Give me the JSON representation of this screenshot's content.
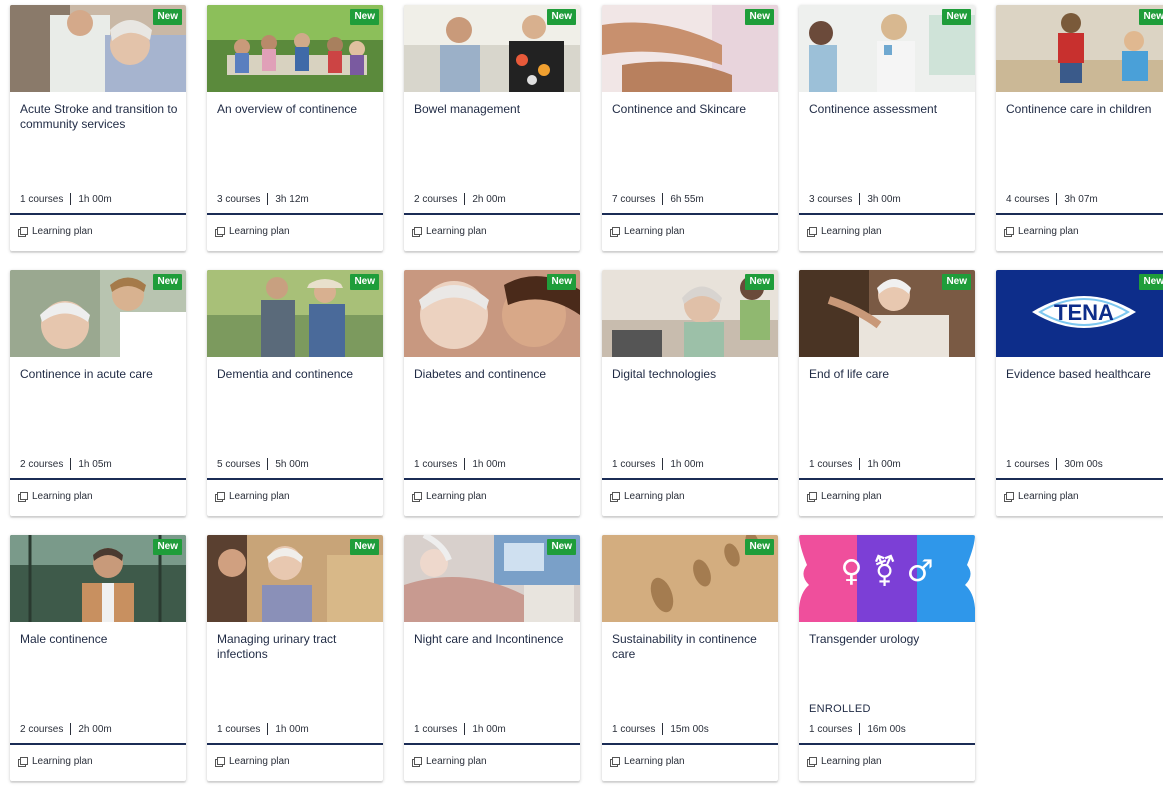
{
  "cards": [
    {
      "title": "Acute Stroke and transition to community services",
      "courses": "1 courses",
      "duration": "1h 00m",
      "badge": "New",
      "footer": "Learning plan",
      "image": "caregiver-with-elderly-woman",
      "enrolled": ""
    },
    {
      "title": "An overview of continence",
      "courses": "3 courses",
      "duration": "3h 12m",
      "badge": "New",
      "footer": "Learning plan",
      "image": "family-outdoor-dinner",
      "enrolled": ""
    },
    {
      "title": "Bowel management",
      "courses": "2 courses",
      "duration": "2h 00m",
      "badge": "New",
      "footer": "Learning plan",
      "image": "couple-at-home",
      "enrolled": ""
    },
    {
      "title": "Continence and Skincare",
      "courses": "7 courses",
      "duration": "6h 55m",
      "badge": "New",
      "footer": "Learning plan",
      "image": "hands-applying-cream",
      "enrolled": ""
    },
    {
      "title": "Continence assessment",
      "courses": "3 courses",
      "duration": "3h 00m",
      "badge": "New",
      "footer": "Learning plan",
      "image": "women-in-kitchen",
      "enrolled": ""
    },
    {
      "title": "Continence care in children",
      "courses": "4 courses",
      "duration": "3h 07m",
      "badge": "New",
      "footer": "Learning plan",
      "image": "children-on-beach",
      "enrolled": ""
    },
    {
      "title": "Continence in acute care",
      "courses": "2 courses",
      "duration": "1h 05m",
      "badge": "New",
      "footer": "Learning plan",
      "image": "nurse-with-smiling-patient",
      "enrolled": ""
    },
    {
      "title": "Dementia and continence",
      "courses": "5 courses",
      "duration": "5h 00m",
      "badge": "New",
      "footer": "Learning plan",
      "image": "two-men-walking",
      "enrolled": ""
    },
    {
      "title": "Diabetes and continence",
      "courses": "1 courses",
      "duration": "1h 00m",
      "badge": "New",
      "footer": "Learning plan",
      "image": "women-embracing",
      "enrolled": ""
    },
    {
      "title": "Digital technologies",
      "courses": "1 courses",
      "duration": "1h 00m",
      "badge": "New",
      "footer": "Learning plan",
      "image": "elderly-woman-laptop",
      "enrolled": ""
    },
    {
      "title": "End of life care",
      "courses": "1 courses",
      "duration": "1h 00m",
      "badge": "New",
      "footer": "Learning plan",
      "image": "hands-holding-elderly",
      "enrolled": ""
    },
    {
      "title": "Evidence based healthcare",
      "courses": "1 courses",
      "duration": "30m 00s",
      "badge": "New",
      "footer": "Learning plan",
      "image": "tena-logo",
      "logo_text": "TENA",
      "enrolled": ""
    },
    {
      "title": "Male continence",
      "courses": "2 courses",
      "duration": "2h 00m",
      "badge": "New",
      "footer": "Learning plan",
      "image": "man-in-greenhouse",
      "enrolled": ""
    },
    {
      "title": "Managing urinary tract infections",
      "courses": "1 courses",
      "duration": "1h 00m",
      "badge": "New",
      "footer": "Learning plan",
      "image": "elderly-woman-visit",
      "enrolled": ""
    },
    {
      "title": "Night care and Incontinence",
      "courses": "1 courses",
      "duration": "1h 00m",
      "badge": "New",
      "footer": "Learning plan",
      "image": "patient-in-bed",
      "enrolled": ""
    },
    {
      "title": "Sustainability in continence care",
      "courses": "1 courses",
      "duration": "15m 00s",
      "badge": "New",
      "footer": "Learning plan",
      "image": "footprints-in-sand",
      "enrolled": ""
    },
    {
      "title": "Transgender urology",
      "courses": "1 courses",
      "duration": "16m 00s",
      "badge": "",
      "footer": "Learning plan",
      "image": "gender-symbols",
      "logo_text": "♀ ⚧ ♂",
      "enrolled": "ENROLLED"
    }
  ],
  "colors": {
    "badge": "#1f9d3a",
    "divider": "#1b2c55",
    "tena_blue": "#0d2d8a",
    "text": "#1f2a44"
  }
}
